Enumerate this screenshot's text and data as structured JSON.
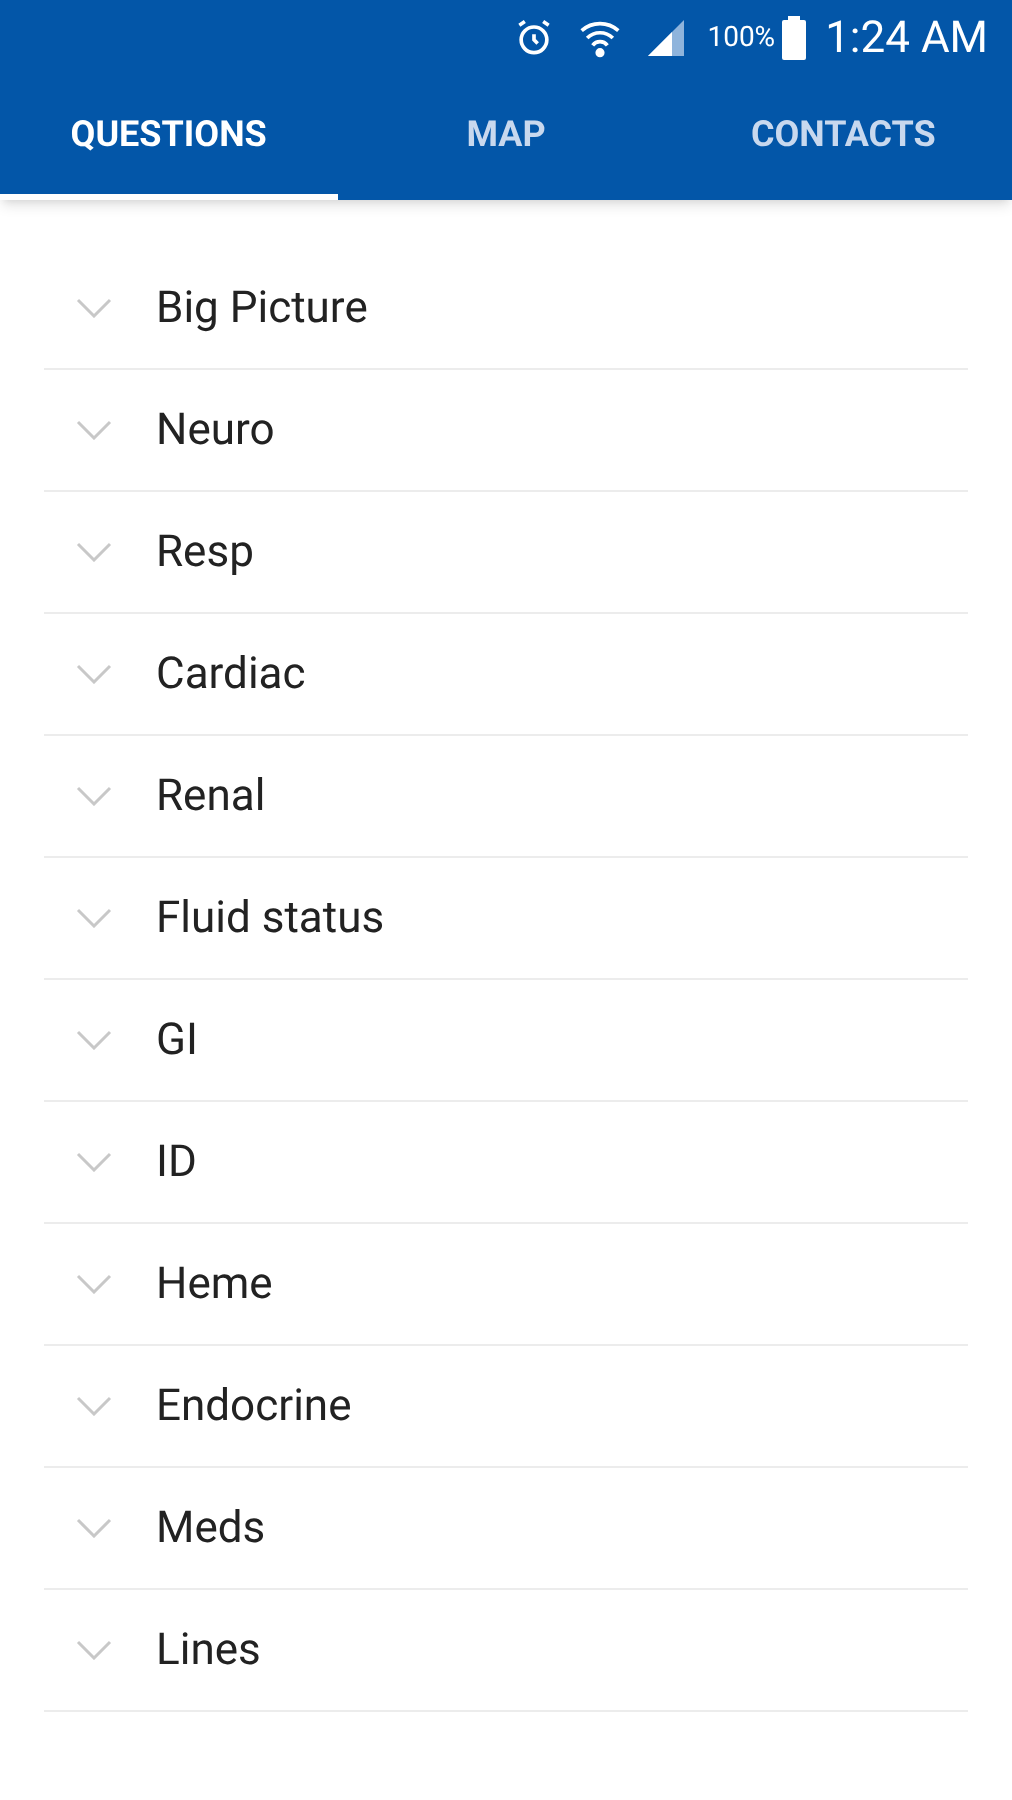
{
  "status_bar": {
    "battery": "100%",
    "time": "1:24 AM"
  },
  "tabs": [
    {
      "label": "QUESTIONS",
      "selected": true
    },
    {
      "label": "MAP",
      "selected": false
    },
    {
      "label": "CONTACTS",
      "selected": false
    }
  ],
  "sections": [
    {
      "label": "Big Picture",
      "expanded": false
    },
    {
      "label": "Neuro",
      "expanded": false
    },
    {
      "label": "Resp",
      "expanded": false
    },
    {
      "label": "Cardiac",
      "expanded": false
    },
    {
      "label": "Renal",
      "expanded": false
    },
    {
      "label": "Fluid status",
      "expanded": false
    },
    {
      "label": "GI",
      "expanded": false
    },
    {
      "label": "ID",
      "expanded": false
    },
    {
      "label": "Heme",
      "expanded": false
    },
    {
      "label": "Endocrine",
      "expanded": false
    },
    {
      "label": "Meds",
      "expanded": false
    },
    {
      "label": "Lines",
      "expanded": false
    }
  ]
}
